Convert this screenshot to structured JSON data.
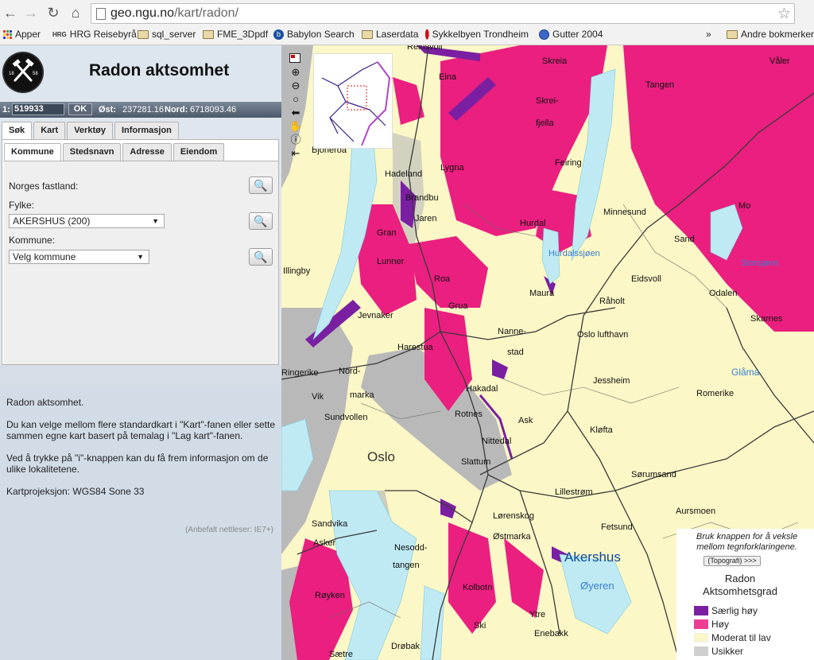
{
  "browser": {
    "url_host": "geo.ngu.no",
    "url_path": "/kart/radon/",
    "bookmarks": [
      {
        "label": "Apper",
        "icon": "apps-grid-icon"
      },
      {
        "label": "HRG Reisebyrå",
        "icon": "hrg-logo-icon"
      },
      {
        "label": "sql_server",
        "icon": "folder-icon"
      },
      {
        "label": "FME_3Dpdf",
        "icon": "folder-icon"
      },
      {
        "label": "Babylon Search",
        "icon": "babylon-icon"
      },
      {
        "label": "Laserdata",
        "icon": "folder-icon"
      },
      {
        "label": "Sykkelbyen Trondheim",
        "icon": "red-hexagon-icon"
      },
      {
        "label": "Gutter 2004",
        "icon": "globe-icon"
      }
    ],
    "overflow_label": "»",
    "other_bookmarks": "Andre bokmerker"
  },
  "app": {
    "title": "Radon aktsomhet",
    "logo_text_left": "18",
    "logo_text_right": "58"
  },
  "coords": {
    "scale_prefix": "1:",
    "scale_value": "519933",
    "ok_label": "OK",
    "east_label": "Øst:",
    "east_value": "237281.16",
    "north_label": "Nord:",
    "north_value": "6718093.46"
  },
  "tabs_main": [
    "Søk",
    "Kart",
    "Verktøy",
    "Informasjon"
  ],
  "tabs_sub": [
    "Kommune",
    "Stedsnavn",
    "Adresse",
    "Eiendom"
  ],
  "search": {
    "mainland_label": "Norges fastland:",
    "county_label": "Fylke:",
    "county_value": "AKERSHUS (200)",
    "municipality_label": "Kommune:",
    "municipality_value": "Velg kommune"
  },
  "info": {
    "p1": "Radon aktsomhet.",
    "p2": "Du kan velge mellom flere standardkart i \"Kart\"-fanen eller sette sammen egne kart basert på temalag i \"Lag kart\"-fanen.",
    "p3": "Ved å trykke på \"i\"-knappen kan du få frem informasjon om de ulike lokalitetene.",
    "p4": "Kartprojeksjon: WGS84 Sone 33",
    "hint": "(Anbefalt nettleser: IE7+)"
  },
  "map": {
    "places": [
      "Reinsvoll",
      "Skreia",
      "Våler",
      "Eina",
      "Tangen",
      "Skrei-",
      "fjella",
      "Bjoneroa",
      "Feiring",
      "Lygna",
      "Hadeland",
      "Brandbu",
      "Jaren",
      "Gran",
      "Hurdal",
      "Minnesund",
      "Mo",
      "Sand",
      "Lunner",
      "Hurdalssjøen",
      "Storsjøen",
      "Illingby",
      "Roa",
      "Eidsvoll",
      "Maura",
      "Råholt",
      "Odalen",
      "Grua",
      "Jevnaker",
      "Skarnes",
      "Nanne-",
      "stad",
      "Oslo lufthavn",
      "Harestua",
      "Ringerike",
      "Nord-",
      "Glåma",
      "Jessheim",
      "Hakadal",
      "Vik",
      "marka",
      "Romerike",
      "Sundvollen",
      "Rotnes",
      "Ask",
      "Kløfta",
      "Nittedal",
      "Oslo",
      "Slattum",
      "Sørumsand",
      "Lillestrøm",
      "Aursmoen",
      "Sandvika",
      "Lørenskog",
      "Fetsund",
      "Asker",
      "Østmarka",
      "Nesodd-",
      "tangen",
      "Akershus",
      "Røyken",
      "Kolbotn",
      "Øyeren",
      "Ytre",
      "Ski",
      "Enebakk",
      "Drøbak",
      "Sætre"
    ],
    "legend": {
      "note": "Bruk knappen for å veksle mellom tegnforklaringene.",
      "toggle_label": "(Topografi) >>>",
      "title_line1": "Radon",
      "title_line2": "Aktsomhetsgrad",
      "items": [
        {
          "label": "Særlig høy",
          "color": "#7a1fa2"
        },
        {
          "label": "Høy",
          "color": "#ee3d96"
        },
        {
          "label": "Moderat til lav",
          "color": "#fbf7c6"
        },
        {
          "label": "Usikker",
          "color": "#cfcfcf"
        }
      ]
    },
    "colors": {
      "moderate": "#fbf7c6",
      "high": "#ea1f7f",
      "very_high": "#7a1fa2",
      "uncertain": "#b9b9b9",
      "water": "#bfeaf4"
    }
  }
}
